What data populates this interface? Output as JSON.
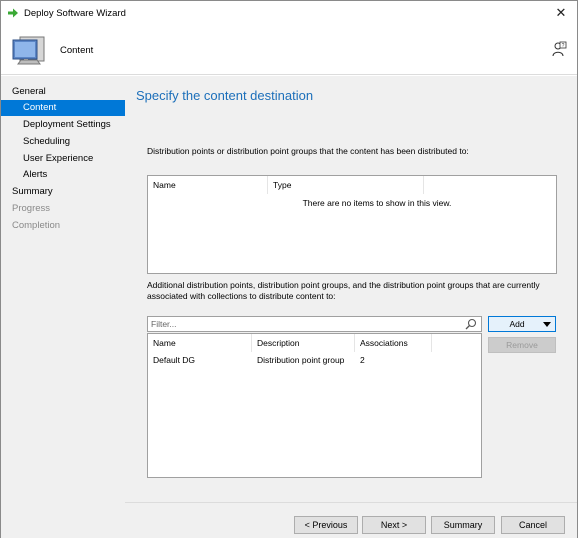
{
  "window": {
    "title": "Deploy Software Wizard",
    "close_label": "✕"
  },
  "header": {
    "title": "Content"
  },
  "sidebar": {
    "items": [
      {
        "label": "General",
        "state": "normal",
        "level": 0
      },
      {
        "label": "Content",
        "state": "active",
        "level": 1
      },
      {
        "label": "Deployment Settings",
        "state": "normal",
        "level": 1
      },
      {
        "label": "Scheduling",
        "state": "normal",
        "level": 1
      },
      {
        "label": "User Experience",
        "state": "normal",
        "level": 1
      },
      {
        "label": "Alerts",
        "state": "normal",
        "level": 1
      },
      {
        "label": "Summary",
        "state": "normal",
        "level": 0
      },
      {
        "label": "Progress",
        "state": "disabled",
        "level": 0
      },
      {
        "label": "Completion",
        "state": "disabled",
        "level": 0
      }
    ]
  },
  "main": {
    "heading": "Specify the content destination",
    "distributed_label": "Distribution points or distribution point groups that the content has been distributed to:",
    "list1": {
      "columns": [
        "Name",
        "Type"
      ],
      "empty_message": "There are no items to show in this view."
    },
    "additional_label": "Additional distribution points, distribution point groups, and the distribution point groups that are currently associated with collections to distribute content to:",
    "filter_placeholder": "Filter...",
    "add_label": "Add",
    "remove_label": "Remove",
    "list2": {
      "columns": [
        "Name",
        "Description",
        "Associations"
      ],
      "rows": [
        {
          "name": "Default DG",
          "description": "Distribution point group",
          "associations": "2"
        }
      ]
    }
  },
  "footer": {
    "previous_label": "< Previous",
    "next_label": "Next >",
    "summary_label": "Summary",
    "cancel_label": "Cancel"
  },
  "colors": {
    "accent": "#0078d7",
    "heading": "#1c6fba",
    "panel": "#f0f0f0"
  }
}
